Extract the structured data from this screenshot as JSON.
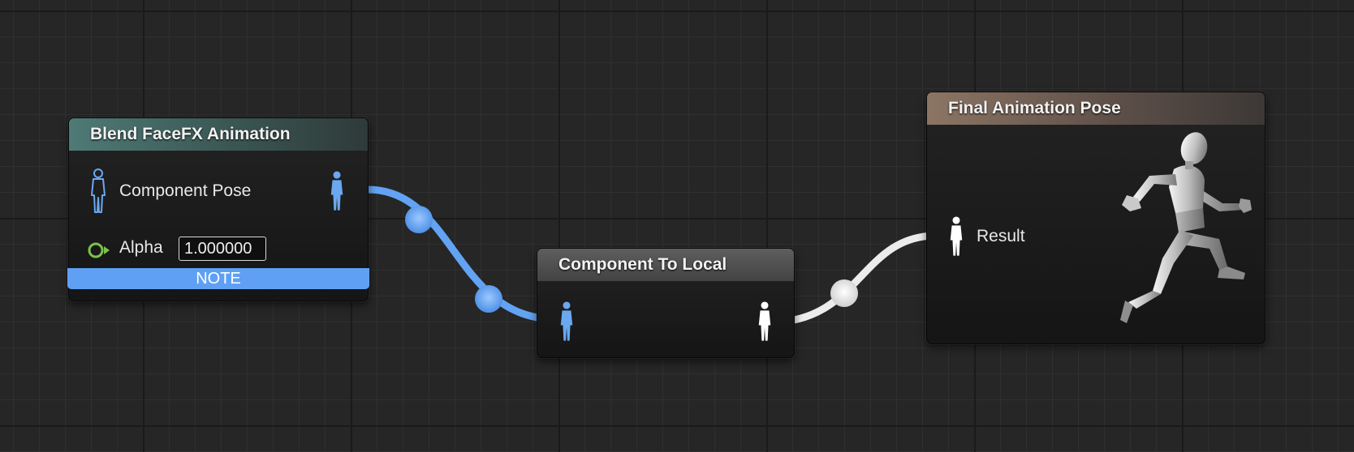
{
  "colors": {
    "pose_pin_blue": "#6aa8f0",
    "pose_pin_white": "#ffffff",
    "alpha_pin_green": "#7cc24a",
    "note_blue": "#5fa0f5",
    "grid_background": "#262626"
  },
  "nodes": {
    "blend_facefx": {
      "title": "Blend FaceFX Animation",
      "input_pin_label": "Component Pose",
      "alpha_label": "Alpha",
      "alpha_value": "1.000000",
      "note_label": "NOTE"
    },
    "component_to_local": {
      "title": "Component To Local"
    },
    "final_pose": {
      "title": "Final Animation Pose",
      "result_label": "Result",
      "preview_icon": "running-mannequin-icon"
    }
  }
}
